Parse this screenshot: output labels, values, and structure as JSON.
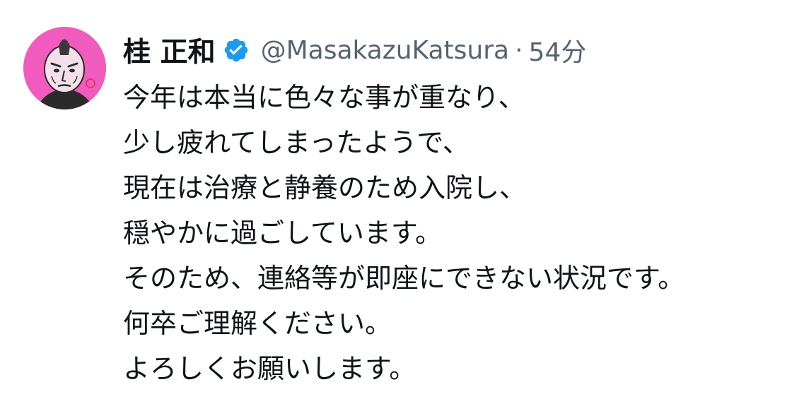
{
  "tweet": {
    "author": {
      "display_name": "桂 正和",
      "handle": "@MasakazuKatsura",
      "verified": true,
      "avatar_icon": "avatar-icon"
    },
    "separator": "·",
    "timestamp": "54分",
    "lines": [
      "今年は本当に色々な事が重なり、",
      "少し疲れてしまったようで、",
      "現在は治療と静養のため入院し、",
      "穏やかに過ごしています。",
      "そのため、連絡等が即座にできない状況です。",
      "何卒ご理解ください。",
      "よろしくお願いします。"
    ]
  },
  "colors": {
    "text_primary": "#0f1419",
    "text_secondary": "#536471",
    "verified_badge": "#1d9bf0",
    "avatar_background": "#f05bbd"
  }
}
